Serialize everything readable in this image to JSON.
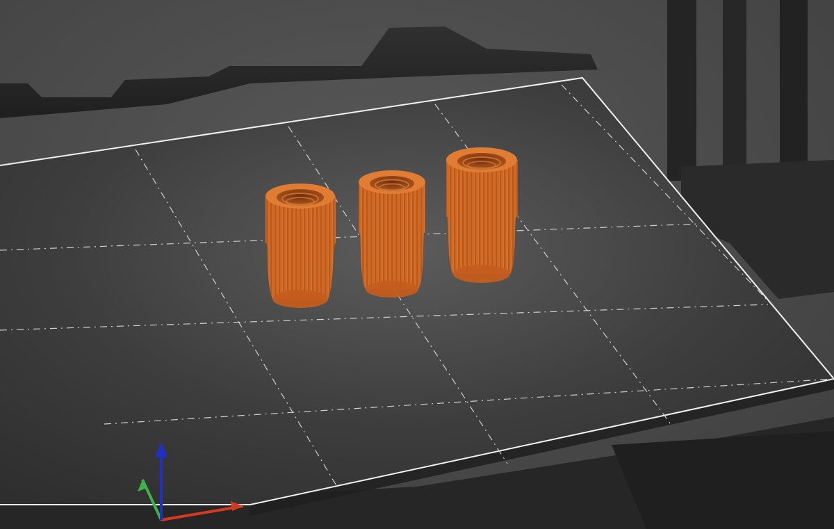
{
  "viewport": {
    "background_color": "#4b4b4b",
    "bed_color": "#353535",
    "bed_edge_color": "#f2f2f2",
    "bed_grid_color": "#d8d8d8",
    "printer_frame_color": "#2a2a2a",
    "printer_shadow_color": "#1f1f1f"
  },
  "objects": [
    {
      "name": "knurled-threaded-spacer-1",
      "color": "#d86a1e",
      "icon": "threaded-cylinder-icon"
    },
    {
      "name": "knurled-threaded-spacer-2",
      "color": "#d86a1e",
      "icon": "threaded-cylinder-icon"
    },
    {
      "name": "knurled-threaded-spacer-3",
      "color": "#d86a1e",
      "icon": "threaded-cylinder-icon"
    }
  ],
  "axes": {
    "x_color": "#d43a1f",
    "y_color": "#3bb24a",
    "z_color": "#1f2fc8",
    "icon": "axis-gizmo-icon"
  }
}
